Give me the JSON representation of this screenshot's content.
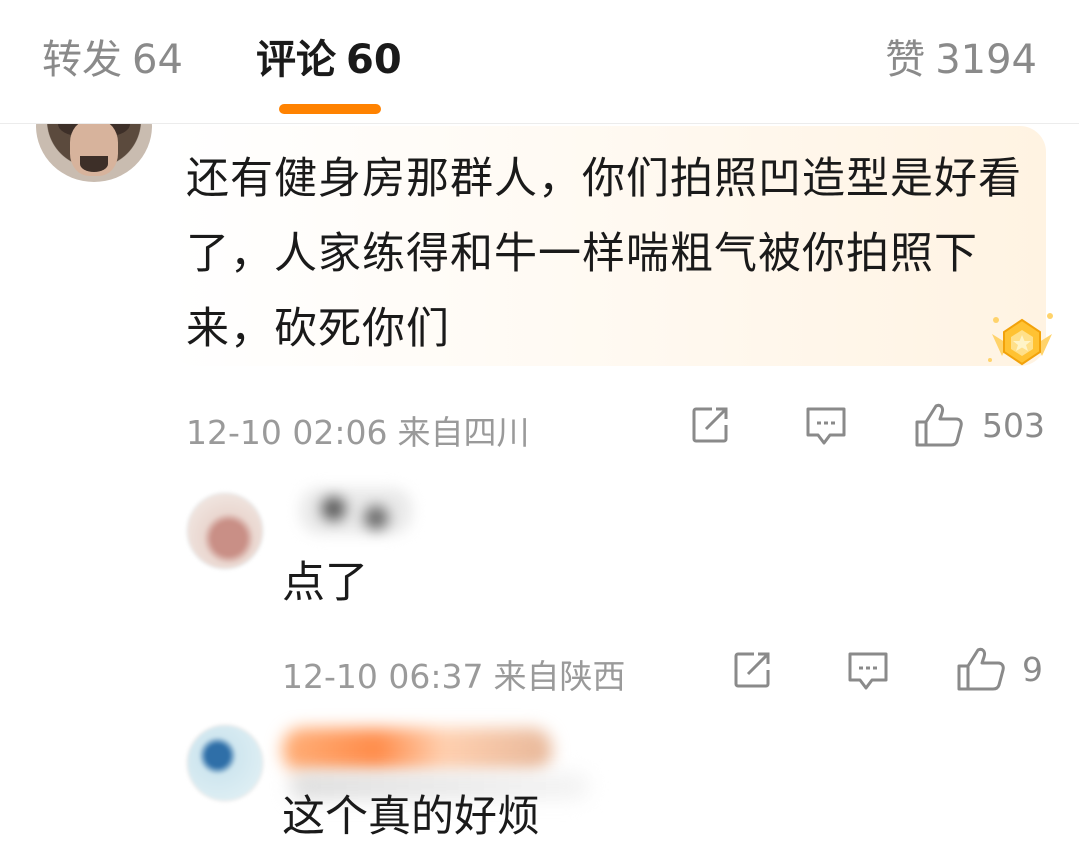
{
  "tabs": {
    "repost": {
      "label": "转发",
      "count": "64"
    },
    "comments": {
      "label": "评论",
      "count": "60"
    },
    "likes": {
      "label": "赞",
      "count": "3194"
    }
  },
  "main_comment": {
    "text": "还有健身房那群人，你们拍照凹造型是好看了，人家练得和牛一样喘粗气被你拍照下来，砍死你们",
    "time": "12-10 02:06",
    "location": "来自四川",
    "like_count": "503"
  },
  "replies": [
    {
      "text": "点了",
      "time": "12-10 06:37",
      "location": "来自陕西",
      "like_count": "9"
    },
    {
      "text": "这个真的好烦"
    }
  ],
  "icons": {
    "share": "share-icon",
    "comment": "comment-icon",
    "like": "thumbs-up-icon",
    "badge": "gold-badge-icon"
  },
  "colors": {
    "accent": "#ff8200",
    "muted_text": "#9a9a9a",
    "primary_text": "#1a1a1a"
  }
}
